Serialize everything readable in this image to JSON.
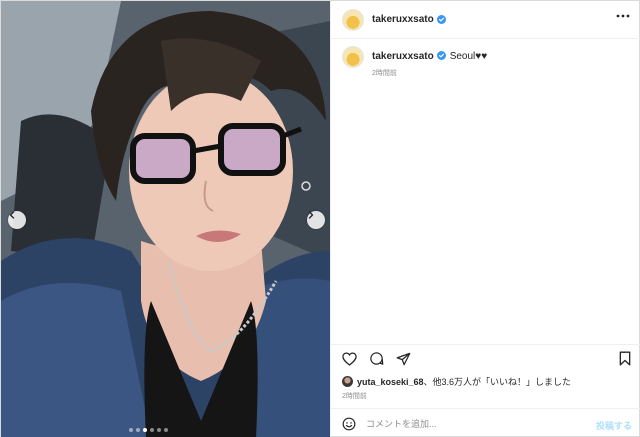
{
  "post": {
    "username": "takeruxxsato",
    "caption": "Seoul♥♥",
    "caption_time": "2時間前",
    "liked_by_user": "yuta_koseki_68",
    "likes_text": "、他3.6万人が「いいね！」しました",
    "post_time": "2時間前"
  },
  "photo": {
    "slide_count": 6,
    "active_slide": 3
  },
  "comment": {
    "placeholder": "コメントを追加...",
    "value": "",
    "post_label": "投稿する"
  },
  "colors": {
    "verified": "#3897f0",
    "post_button_disabled": "#b2dffc",
    "secondary_text": "#8e8e8e"
  },
  "icons": [
    "verified-badge-icon",
    "more-options-icon",
    "heart-icon",
    "comment-icon",
    "share-icon",
    "bookmark-icon",
    "emoji-icon",
    "chevron-left-icon",
    "chevron-right-icon"
  ]
}
